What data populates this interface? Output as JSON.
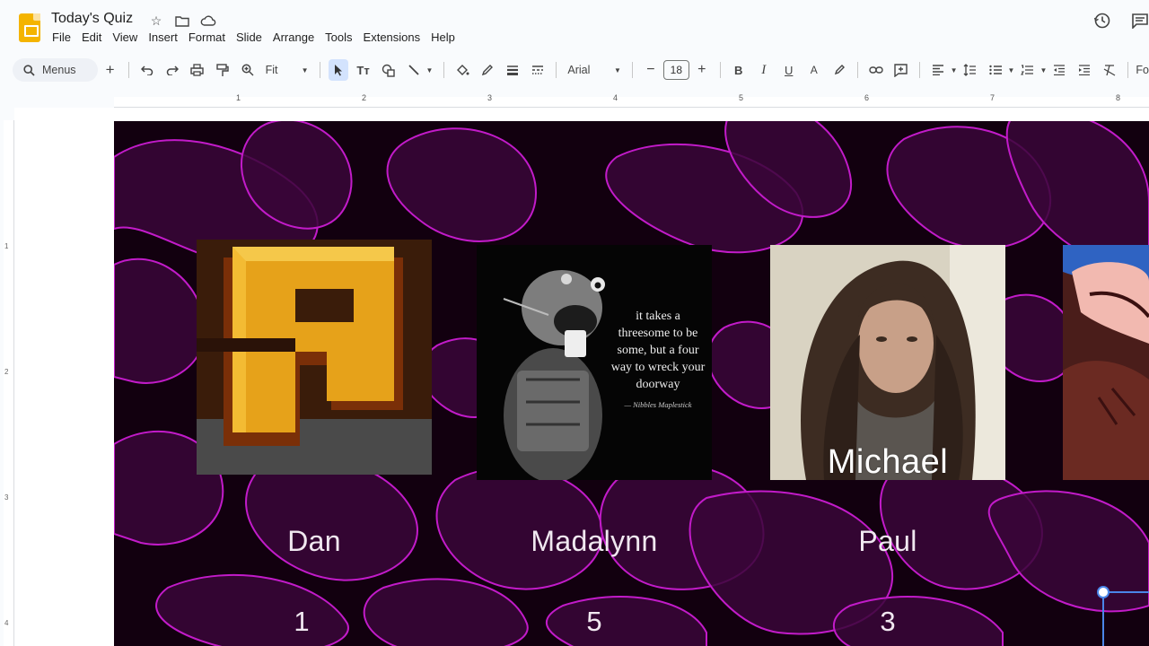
{
  "app": {
    "title": "Today's Quiz",
    "menus": [
      "File",
      "Edit",
      "View",
      "Insert",
      "Format",
      "Slide",
      "Arrange",
      "Tools",
      "Extensions",
      "Help"
    ]
  },
  "toolbar": {
    "search_label": "Menus",
    "zoom": "Fit",
    "font": "Arial",
    "font_size": "18",
    "overflow_label": "Fo"
  },
  "ruler": {
    "h": [
      "1",
      "2",
      "3",
      "4",
      "5",
      "6",
      "7",
      "8"
    ],
    "v": [
      "1",
      "2",
      "3",
      "4"
    ]
  },
  "slide": {
    "quote": {
      "text": "it takes a threesome to be some, but a four way to wreck your doorway",
      "author": "— Nibbles Maplestick"
    },
    "image_caption": "Michael",
    "players": [
      {
        "name": "Dan",
        "score": "1"
      },
      {
        "name": "Madalynn",
        "score": "5"
      },
      {
        "name": "Paul",
        "score": "3"
      }
    ]
  },
  "colors": {
    "accent": "#c21bc9",
    "slide_bg": "#12000f",
    "selection": "#4a86e8"
  }
}
